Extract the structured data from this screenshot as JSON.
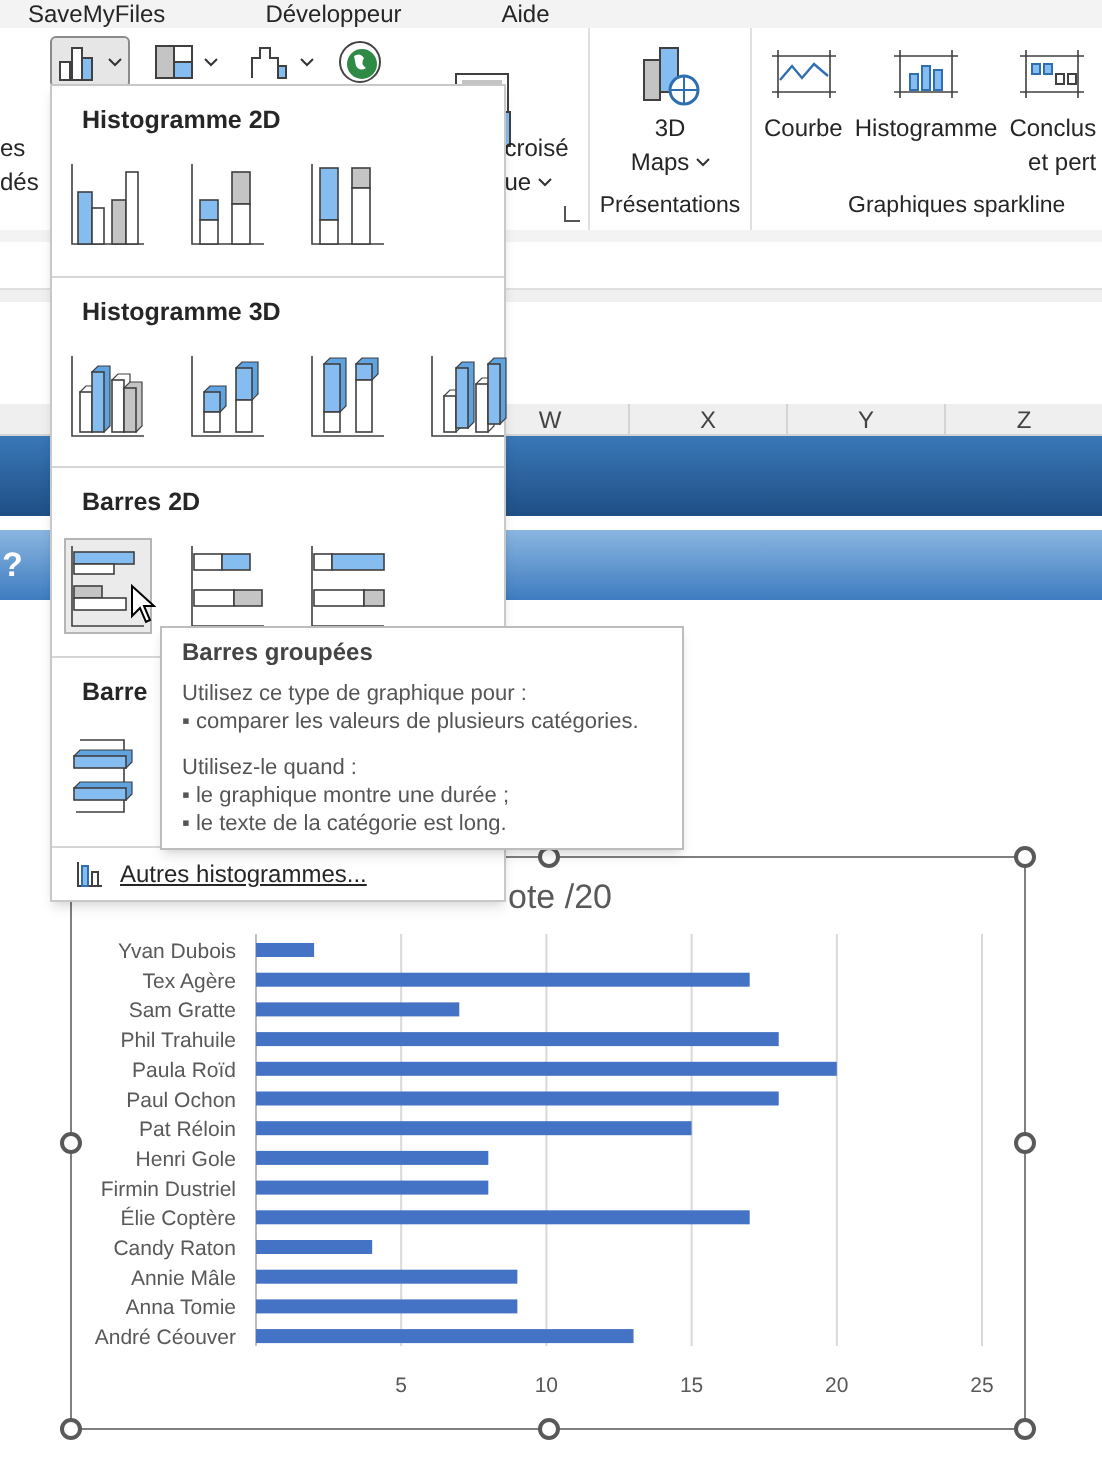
{
  "ribbon_tabs": [
    {
      "label": "SaveMyFiles"
    },
    {
      "label": "Développeur"
    },
    {
      "label": "Aide"
    }
  ],
  "ribbon": {
    "cut_label_lines": [
      "es",
      "dés"
    ],
    "chart_buttons": [
      {
        "kind": "column",
        "selected": true
      },
      {
        "kind": "hierarchy",
        "selected": false
      },
      {
        "kind": "waterfall",
        "selected": false
      }
    ],
    "pivot_chart_lines": [
      "croisé",
      "ue"
    ],
    "maps_lines": [
      "3D",
      "Maps"
    ],
    "presentations_group": "Présentations",
    "sparklines": [
      {
        "kind": "line",
        "label_lines": [
          "Courbe"
        ]
      },
      {
        "kind": "column",
        "label_lines": [
          "Histogramme"
        ]
      },
      {
        "kind": "winloss",
        "label_lines": [
          "Conclus",
          "et pert"
        ]
      }
    ],
    "sparkline_group": "Graphiques sparkline"
  },
  "sheet": {
    "columns": [
      "W",
      "X",
      "Y",
      "Z"
    ],
    "banner_text": "?"
  },
  "menu": {
    "sections": [
      {
        "title": "Histogramme 2D",
        "items": [
          {
            "kind": "col-clustered",
            "selected": false
          },
          {
            "kind": "col-stacked",
            "selected": false
          },
          {
            "kind": "col-percent",
            "selected": false
          }
        ]
      },
      {
        "title": "Histogramme 3D",
        "items": [
          {
            "kind": "col3d-clustered",
            "selected": false
          },
          {
            "kind": "col3d-stacked",
            "selected": false
          },
          {
            "kind": "col3d-percent",
            "selected": false
          },
          {
            "kind": "col3d",
            "selected": false
          }
        ]
      },
      {
        "title": "Barres 2D",
        "items": [
          {
            "kind": "bar-clustered",
            "selected": true
          },
          {
            "kind": "bar-stacked",
            "selected": false
          },
          {
            "kind": "bar-percent",
            "selected": false
          }
        ]
      },
      {
        "title": "Barre",
        "items": [
          {
            "kind": "bar3d",
            "selected": false
          }
        ]
      }
    ],
    "more": "Autres histogrammes..."
  },
  "tooltip": {
    "title": "Barres groupées",
    "paragraphs": [
      {
        "lines": [
          "Utilisez ce type de graphique pour :",
          "▪ comparer les valeurs de plusieurs catégories."
        ]
      },
      {
        "lines": [
          "Utilisez-le quand :",
          "▪ le graphique montre une durée ;",
          "▪ le texte de la catégorie est long."
        ]
      }
    ]
  },
  "chart": {
    "title": "ote /20",
    "chart_data": {
      "type": "bar",
      "orientation": "horizontal",
      "categories": [
        "Yvan Dubois",
        "Tex Agère",
        "Sam Gratte",
        "Phil Trahuile",
        "Paula Roïd",
        "Paul Ochon",
        "Pat Réloin",
        "Henri Gole",
        "Firmin Dustriel",
        "Élie Coptère",
        "Candy Raton",
        "Annie Mâle",
        "Anna Tomie",
        "André Céouver"
      ],
      "grid": true,
      "series": [
        {
          "color": "#4472c4",
          "values": [
            2,
            17,
            7,
            18,
            20,
            18,
            15,
            8,
            8,
            17,
            4,
            9,
            9,
            13
          ]
        }
      ],
      "xlim": [
        0,
        25
      ],
      "xticks": [
        5,
        10,
        15,
        20,
        25
      ]
    }
  }
}
